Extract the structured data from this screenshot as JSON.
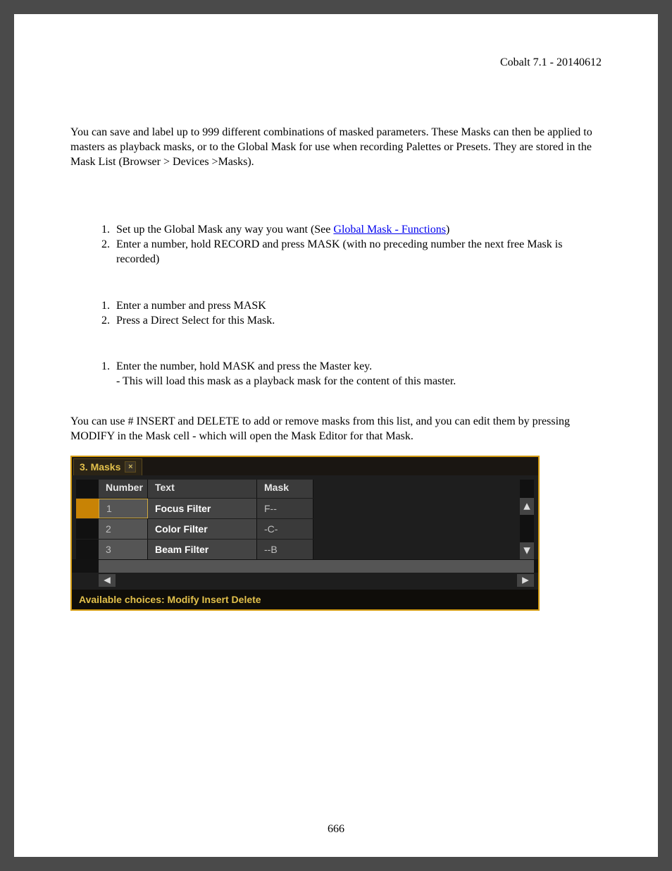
{
  "header": {
    "product_version": "Cobalt 7.1 - 20140612"
  },
  "intro": "You can save and label up to 999 different combinations of masked parameters. These Masks can then be applied to masters as playback masks, or to the Global Mask for use when recording Palettes or Presets. They are stored in the Mask List (Browser > Devices >Masks).",
  "listA": {
    "item1_pre": "Set up the Global Mask any way you want (See ",
    "item1_link": "Global Mask - Functions",
    "item1_post": ")",
    "item2": "Enter a number, hold RECORD and press MASK (with no preceding number the next free Mask is recorded)"
  },
  "listB": {
    "item1": "Enter a number and press MASK",
    "item2": "Press a Direct Select for this Mask."
  },
  "listC": {
    "item1": "Enter the number, hold MASK and press the Master key.",
    "item1_sub": "- This will load this mask as a playback mask for the content of this master."
  },
  "outro": "You can use # INSERT and DELETE to add or remove masks from this list, and you can edit them by pressing MODIFY in the Mask cell - which will open the Mask Editor for that Mask.",
  "panel": {
    "tab_title": "3. Masks",
    "columns": {
      "number": "Number",
      "text": "Text",
      "mask": "Mask"
    },
    "rows": [
      {
        "number": "1",
        "text": "Focus Filter",
        "mask": "F--",
        "selected": true
      },
      {
        "number": "2",
        "text": "Color Filter",
        "mask": "-C-",
        "selected": false
      },
      {
        "number": "3",
        "text": "Beam Filter",
        "mask": "--B",
        "selected": false
      }
    ],
    "footer": "Available choices: Modify Insert Delete"
  },
  "page_number": "666"
}
